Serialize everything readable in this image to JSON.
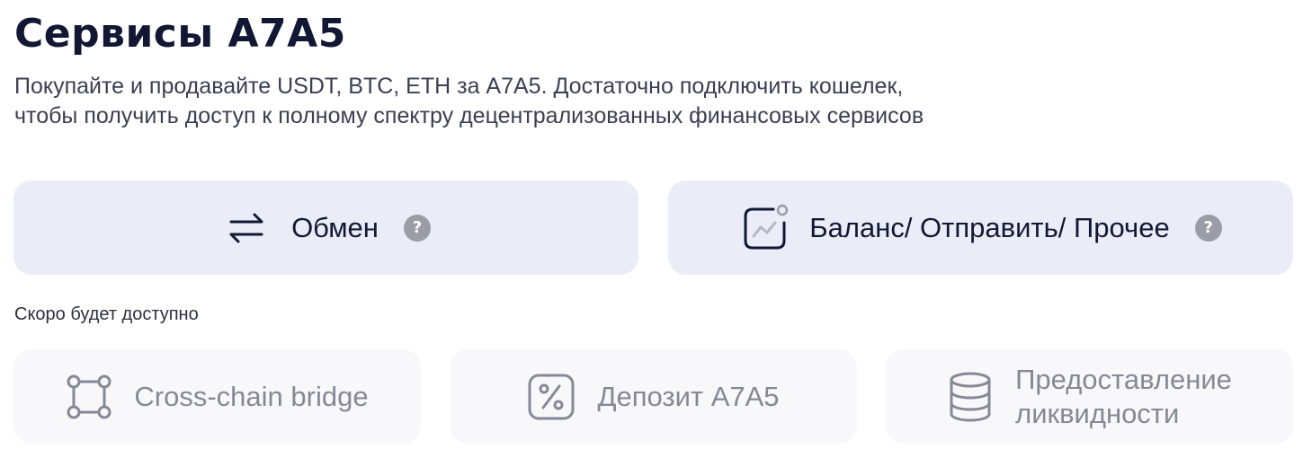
{
  "header": {
    "title": "Сервисы A7A5",
    "subtitle_lines": [
      "Покупайте и продавайте USDT, BTC, ETH за A7A5. Достаточно подключить кошелек,",
      "чтобы получить доступ к полному спектру децентрализованных финансовых сервисов"
    ]
  },
  "services": {
    "exchange": {
      "label": "Обмен",
      "icon": "swap-arrows-icon",
      "help": "?"
    },
    "balance": {
      "label": "Баланс/ Отправить/ Прочее",
      "icon": "chart-icon",
      "help": "?"
    }
  },
  "coming_soon": {
    "label": "Скоро будет доступно",
    "items": [
      {
        "label_lines": [
          "Cross-chain bridge"
        ],
        "icon": "bridge-nodes-icon"
      },
      {
        "label_lines": [
          "Депозит A7A5"
        ],
        "icon": "percent-icon"
      },
      {
        "label_lines": [
          "Предоставление",
          "ликвидности"
        ],
        "icon": "database-icon"
      }
    ]
  },
  "colors": {
    "primary_card_bg": "#eaedf8",
    "disabled_card_bg": "#f8f8fa",
    "text_dark": "#121733",
    "text_disabled": "#858996",
    "help_badge": "#9a9ca6"
  }
}
